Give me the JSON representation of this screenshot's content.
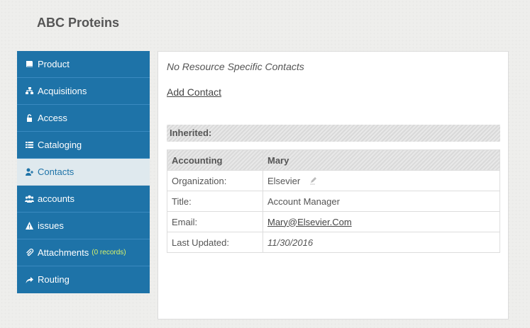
{
  "page_title": "ABC Proteins",
  "sidebar": {
    "items": [
      {
        "label": "Product",
        "icon": "book-icon"
      },
      {
        "label": "Acquisitions",
        "icon": "sitemap-icon"
      },
      {
        "label": "Access",
        "icon": "unlock-icon"
      },
      {
        "label": "Cataloging",
        "icon": "list-icon"
      },
      {
        "label": "Contacts",
        "icon": "user-plus-icon"
      },
      {
        "label": "accounts",
        "icon": "users-icon"
      },
      {
        "label": "issues",
        "icon": "warning-icon"
      },
      {
        "label": "Attachments",
        "icon": "paperclip-icon",
        "count": "(0 records)"
      },
      {
        "label": "Routing",
        "icon": "share-icon"
      }
    ],
    "active": "Contacts"
  },
  "content": {
    "no_contacts": "No Resource Specific Contacts",
    "add_contact": "Add Contact",
    "inherited_label": "Inherited:",
    "contact": {
      "role": "Accounting",
      "name": "Mary",
      "rows": [
        {
          "key": "Organization:",
          "value": "Elsevier"
        },
        {
          "key": "Title:",
          "value": "Account Manager"
        },
        {
          "key": "Email:",
          "value": "Mary@Elsevier.Com"
        },
        {
          "key": "Last Updated:",
          "value": "11/30/2016"
        }
      ]
    }
  },
  "colors": {
    "sidebar_bg": "#1e73a8",
    "active_bg": "#dfe9ee",
    "count_color": "#d6f26b"
  }
}
